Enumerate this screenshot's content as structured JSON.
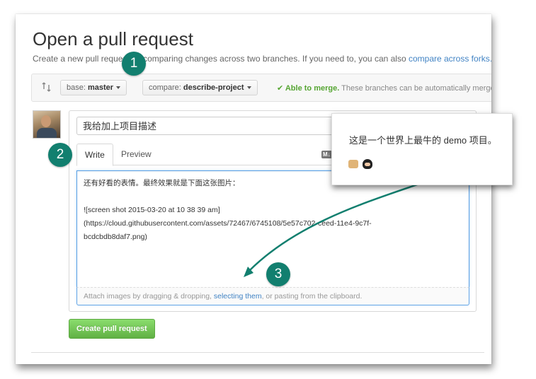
{
  "header": {
    "title": "Open a pull request",
    "subtitle_text": "Create a new pull request by comparing changes across two branches. If you need to, you can also ",
    "subtitle_link": "compare across forks."
  },
  "range": {
    "base_prefix": "base: ",
    "base_branch": "master",
    "separator": "...",
    "compare_prefix": "compare: ",
    "compare_branch": "describe-project",
    "merge_status": "✔ Able to merge.",
    "merge_note": "These branches can be automatically merged."
  },
  "form": {
    "title_value": "我给加上项目描述",
    "tabs": [
      "Write",
      "Preview"
    ],
    "markdown_icon": "M↓",
    "body_text": "还有好看的表情。最终效果就是下面这张图片：\n\n![screen shot 2015-03-20 at 10 38 39 am]\n(https://cloud.githubusercontent.com/assets/72467/6745108/5e57c702-ceed-11e4-9c7f-\nbcdcbdb8daf7.png)",
    "attach_prefix": "Attach images by dragging & dropping, ",
    "attach_link": "selecting them",
    "attach_suffix": ", or pasting from the clipboard.",
    "submit_label": "Create pull request"
  },
  "annotations": {
    "steps": [
      "1",
      "2",
      "3"
    ],
    "popup_text": "这是一个世界上最牛的 demo 项目。",
    "popup_icons": [
      "thumbs-up-icon",
      "octocat-icon"
    ],
    "accent_color": "#127f6f"
  },
  "colors": {
    "link": "#4183c4",
    "merge_ok": "#55a532",
    "submit": "#60b044"
  }
}
